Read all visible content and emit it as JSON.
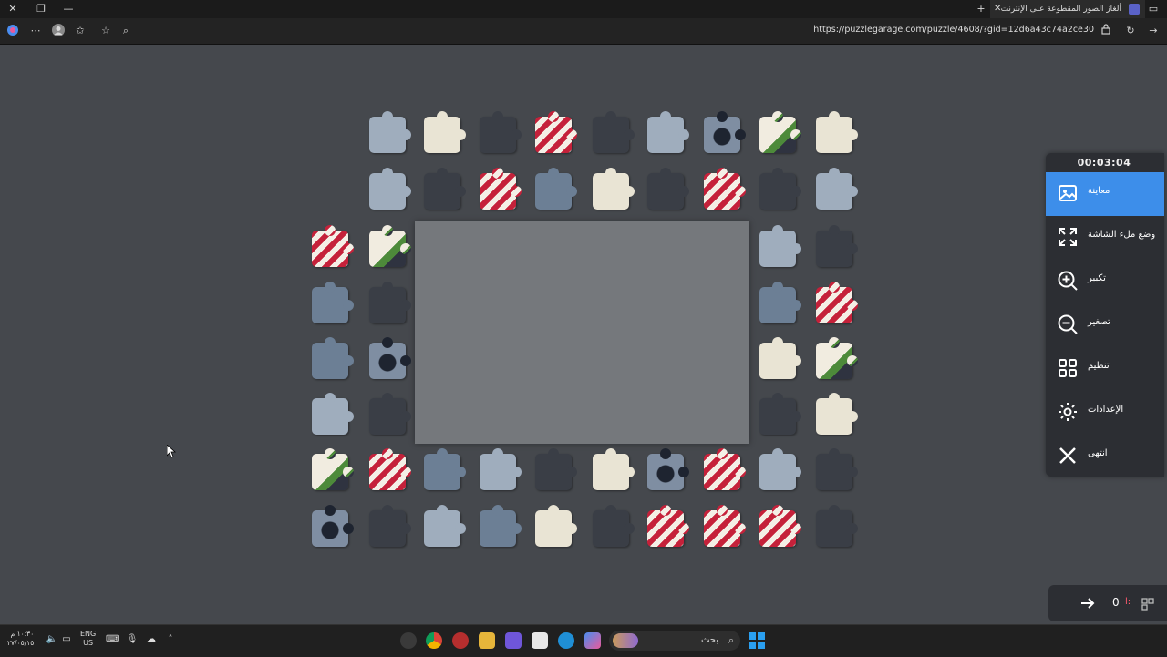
{
  "browser": {
    "tab_title": "ألغاز الصور المقطوعة على الإنترنت",
    "url": "https://puzzlegarage.com/puzzle/4608/?gid=12d6a43c74a2ce30"
  },
  "panel": {
    "timer": "00:03:04",
    "items": [
      {
        "label": "معاينة",
        "icon": "image-preview-icon",
        "active": true
      },
      {
        "label": "وضع ملء الشاشة",
        "icon": "fullscreen-icon",
        "active": false
      },
      {
        "label": "تكبير",
        "icon": "zoom-in-icon",
        "active": false
      },
      {
        "label": "تصغير",
        "icon": "zoom-out-icon",
        "active": false
      },
      {
        "label": "تنظيم",
        "icon": "grid-organize-icon",
        "active": false
      },
      {
        "label": "الإعدادات",
        "icon": "gear-icon",
        "active": false
      },
      {
        "label": "انتهى",
        "icon": "close-icon",
        "active": false
      }
    ]
  },
  "score": {
    "value": "0",
    "label": "ا:"
  },
  "taskbar": {
    "search_label": "بحث",
    "lang_line1": "ENG",
    "lang_line2": "US",
    "clock_time": "١٠:٣٠ م",
    "clock_date": "٢٧/٠٥/١٥"
  },
  "colors": {
    "accent": "#3d8eea",
    "background": "#45484d",
    "board": "#75787c"
  }
}
